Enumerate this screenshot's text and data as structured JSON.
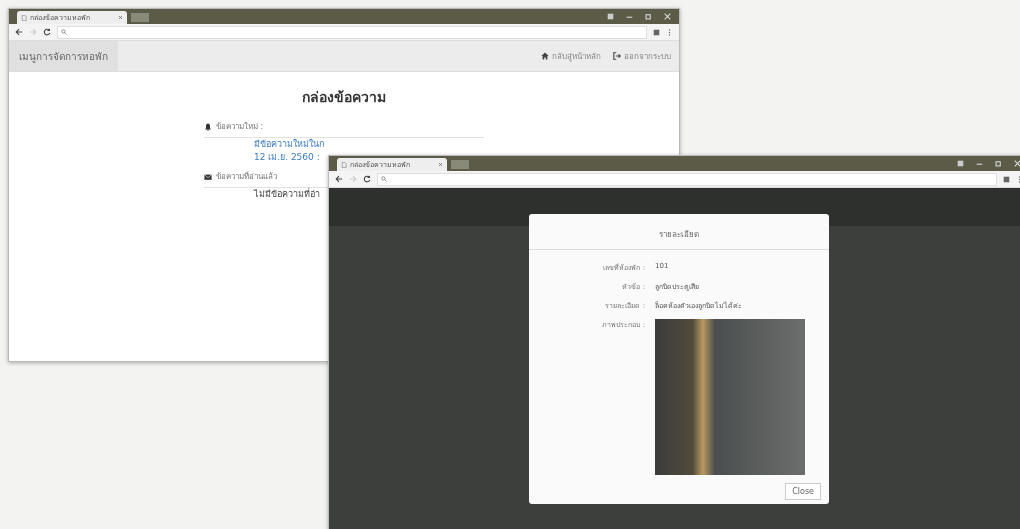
{
  "back_window": {
    "tab_title": "กล่องข้อความหอพัก",
    "navbar": {
      "brand": "เมนูการจัดการหอพัก",
      "links": [
        {
          "kind": "home",
          "label": "กลับสู่หน้าหลัก"
        },
        {
          "kind": "logout",
          "label": "ออกจากระบบ"
        }
      ]
    },
    "heading": "กล่องข้อความ",
    "sections": [
      {
        "kind": "new",
        "title": "ข้อความใหม่ :",
        "lines": [
          "มีข้อความใหม่ในก",
          "12 เม.ย. 2560 :"
        ],
        "link": true
      },
      {
        "kind": "read",
        "title": "ข้อความที่อ่านแล้ว",
        "lines": [
          "ไม่มีข้อความที่อ่า"
        ],
        "link": false
      }
    ]
  },
  "front_window": {
    "tab_title": "กล่องข้อความหอพัก",
    "modal": {
      "title": "รายละเอียด",
      "fields": [
        {
          "label": "เลขที่ห้องพัก :",
          "value": "101"
        },
        {
          "label": "หัวข้อ :",
          "value": "ลูกบิดประตูเสีย"
        },
        {
          "label": "รายละเอียด :",
          "value": "ล็อคห้องตัวเองลูกบิดไม่ได้ค่ะ"
        },
        {
          "label": "ภาพประกอบ :",
          "kind": "image"
        }
      ],
      "close": "Close"
    }
  }
}
